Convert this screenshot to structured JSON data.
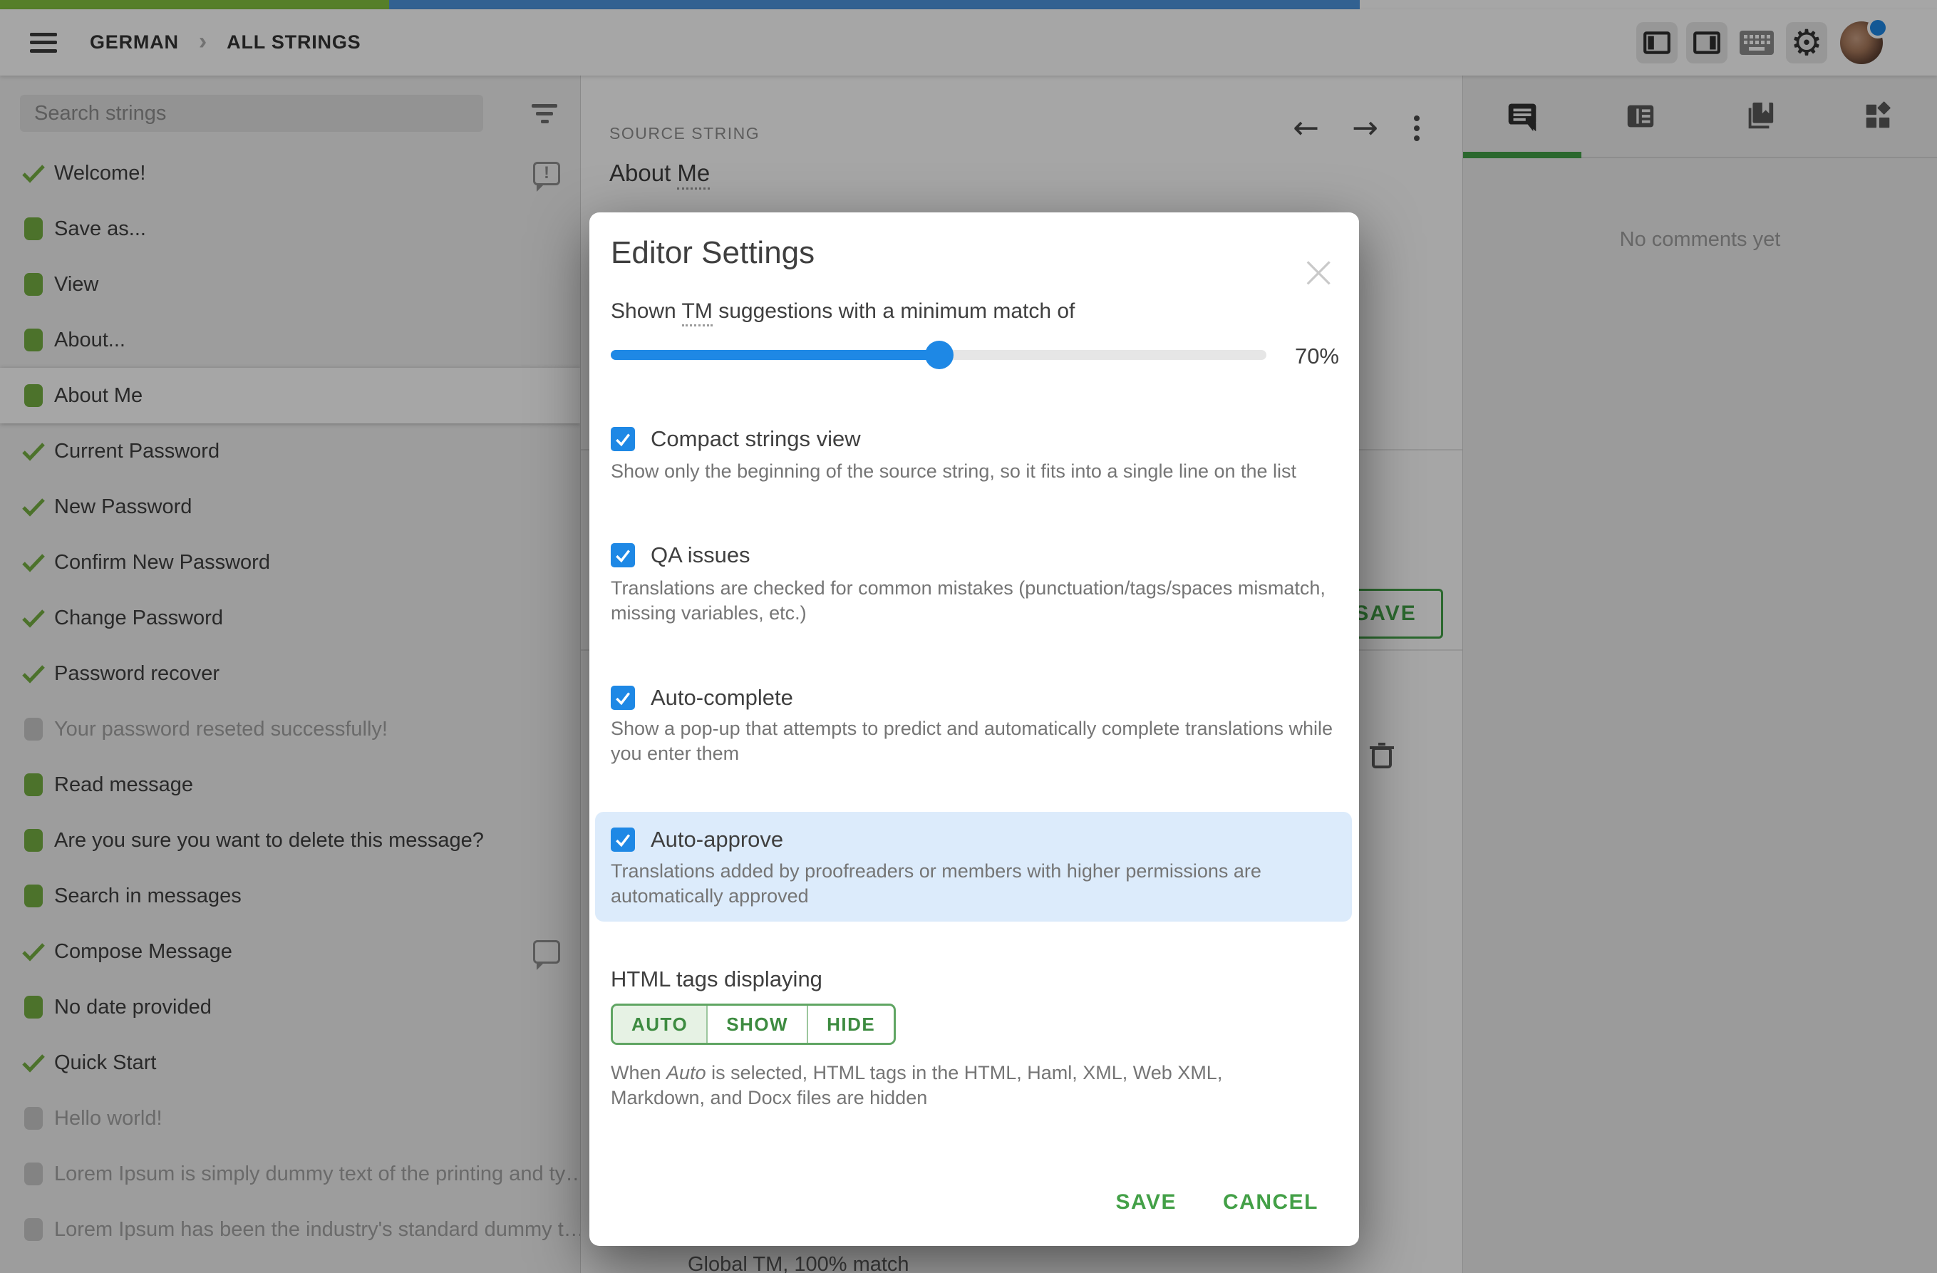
{
  "topbar": {
    "breadcrumb": {
      "project": "GERMAN",
      "section": "ALL STRINGS"
    },
    "icons": [
      "menu-icon",
      "chevron-right-icon",
      "panel-left-icon",
      "panel-right-icon",
      "keyboard-icon",
      "settings-gear-icon",
      "user-avatar",
      "notification-dot"
    ]
  },
  "progress": {
    "segments": [
      {
        "name": "approved",
        "color": "#84C340",
        "percent": 20.1
      },
      {
        "name": "translated",
        "color": "#4E96DF",
        "percent": 50.1
      }
    ]
  },
  "sidebar": {
    "search_placeholder": "Search strings",
    "filter_icon": "filter-icon",
    "items": [
      {
        "label": "Welcome!",
        "status": "approved",
        "note": "issue",
        "selected": false
      },
      {
        "label": "Save as...",
        "status": "translated",
        "note": null,
        "selected": false
      },
      {
        "label": "View",
        "status": "translated",
        "note": null,
        "selected": false
      },
      {
        "label": "About...",
        "status": "translated",
        "note": null,
        "selected": false
      },
      {
        "label": "About Me",
        "status": "translated",
        "note": null,
        "selected": true
      },
      {
        "label": "Current Password",
        "status": "approved",
        "note": null,
        "selected": false
      },
      {
        "label": "New Password",
        "status": "approved",
        "note": null,
        "selected": false
      },
      {
        "label": "Confirm New Password",
        "status": "approved",
        "note": null,
        "selected": false
      },
      {
        "label": "Change Password",
        "status": "approved",
        "note": null,
        "selected": false
      },
      {
        "label": "Password recover",
        "status": "approved",
        "note": null,
        "selected": false
      },
      {
        "label": "Your password reseted successfully!",
        "status": "untranslated",
        "note": null,
        "selected": false
      },
      {
        "label": "Read message",
        "status": "translated",
        "note": null,
        "selected": false
      },
      {
        "label": "Are you sure you want to delete this message?",
        "status": "translated",
        "note": null,
        "selected": false
      },
      {
        "label": "Search in messages",
        "status": "translated",
        "note": null,
        "selected": false
      },
      {
        "label": "Compose Message",
        "status": "approved",
        "note": "comment",
        "selected": false
      },
      {
        "label": "No date provided",
        "status": "translated",
        "note": null,
        "selected": false
      },
      {
        "label": "Quick Start",
        "status": "approved",
        "note": null,
        "selected": false
      },
      {
        "label": "Hello world!",
        "status": "untranslated",
        "note": null,
        "selected": false
      },
      {
        "label": "Lorem Ipsum is simply dummy text of the printing and ty…",
        "status": "untranslated",
        "note": null,
        "selected": false
      },
      {
        "label": "Lorem Ipsum has been the industry's standard dummy t…",
        "status": "untranslated",
        "note": null,
        "selected": false
      }
    ]
  },
  "source_panel": {
    "header": "SOURCE STRING",
    "source_text_prefix": "About ",
    "source_text_term": "Me",
    "nav_icons": [
      "previous-string-arrow",
      "next-string-arrow",
      "kebab-menu"
    ],
    "save_button": "SAVE",
    "tm_suggestion": "Global TM, 100% match",
    "trash_icon": "delete-suggestion-icon"
  },
  "right_panel": {
    "tabs": [
      {
        "name": "comments-tab",
        "active": true
      },
      {
        "name": "context-tab",
        "active": false
      },
      {
        "name": "translation-memory-tab",
        "active": false
      },
      {
        "name": "apps-tab",
        "active": false
      }
    ],
    "empty_state": "No comments yet",
    "active_tab_color": "#43A047"
  },
  "modal": {
    "title": "Editor Settings",
    "close_icon": "close-icon",
    "tm_match": {
      "prefix": "Shown ",
      "term": "TM",
      "suffix": " suggestions with a minimum match of",
      "value_label": "70%",
      "fill_percent": 50.1
    },
    "options": [
      {
        "label": "Compact strings view",
        "description": "Show only the beginning of the source string, so it fits into a single line on the list",
        "checked": true,
        "highlighted": false
      },
      {
        "label": "QA issues",
        "description": "Translations are checked for common mistakes (punctuation/tags/spaces mismatch, missing variables, etc.)",
        "checked": true,
        "highlighted": false
      },
      {
        "label": "Auto-complete",
        "description": "Show a pop-up that attempts to predict and automatically complete translations while you enter them",
        "checked": true,
        "highlighted": false
      },
      {
        "label": "Auto-approve",
        "description": "Translations added by proofreaders or members with higher permissions are automatically approved",
        "checked": true,
        "highlighted": true
      }
    ],
    "html_tags": {
      "heading": "HTML tags displaying",
      "options": [
        "AUTO",
        "SHOW",
        "HIDE"
      ],
      "selected": "AUTO",
      "description_prefix": "When ",
      "description_term": "Auto",
      "description_suffix": " is selected, HTML tags in the HTML, Haml, XML, Web XML, Markdown, and Docx files are hidden"
    },
    "save_button": "SAVE",
    "cancel_button": "CANCEL"
  },
  "colors": {
    "accent_green": "#43A047",
    "status_green": "#76B043",
    "checkbox_blue": "#1E88E5",
    "highlight_blue": "#DCEBFB",
    "progress_green": "#84C340",
    "progress_blue": "#4E96DF"
  }
}
